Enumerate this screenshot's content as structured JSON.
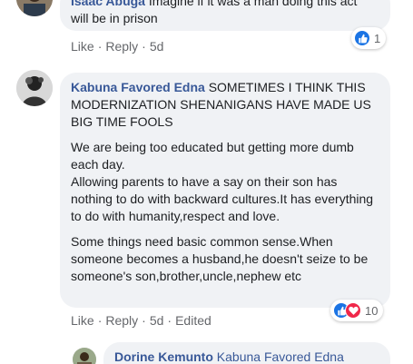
{
  "comment1": {
    "author": "Isaac Abuga",
    "text_line1": "Imagine if it was a man doing this act",
    "text_line2": "will be in prison",
    "actions": {
      "like": "Like",
      "reply": "Reply",
      "time": "5d"
    },
    "reactions": {
      "count": "1"
    }
  },
  "comment2": {
    "author": "Kabuna Favored Edna",
    "intro": "SOMETIMES I THINK THIS MODERNIZATION SHENANIGANS HAVE MADE US BIG TIME FOOLS",
    "paragraph2_line1": "We are being too educated but getting more dumb each day.",
    "paragraph2_line2": "Allowing parents to have a say on their son has nothing to do with backward cultures.It has everything to do with humanity,respect and love.",
    "paragraph3": "Some things need basic common sense.When someone becomes a husband,he doesn't seize to be someone's son,brother,uncle,nephew etc",
    "actions": {
      "like": "Like",
      "reply": "Reply",
      "time": "5d",
      "edited": "Edited"
    },
    "reactions": {
      "count": "10"
    }
  },
  "reply1": {
    "author": "Dorine Kemunto",
    "mention": "Kabuna Favored Edna"
  },
  "colors": {
    "bubble": "#f0f2f5",
    "author": "#385898",
    "like_blue": "#1b74e4",
    "love_red": "#f0284a",
    "meta_gray": "#65676b"
  }
}
